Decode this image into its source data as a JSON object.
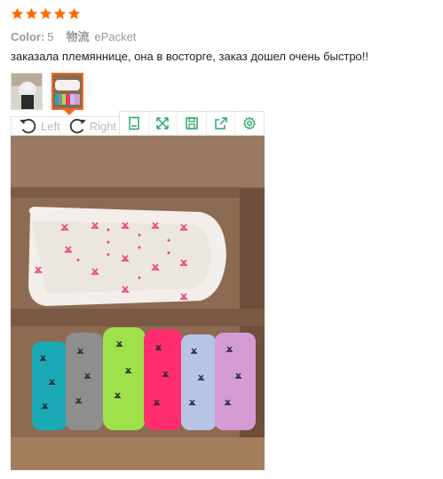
{
  "review": {
    "rating": 5,
    "color_label": "Color:",
    "color_value": "5",
    "shipping_label": "物流",
    "shipping_value": "ePacket",
    "text": "заказала племяннице, она в восторге, заказ дошел очень быстро!!"
  },
  "viewer": {
    "rotate_left_label": "Left",
    "rotate_right_label": "Right"
  },
  "colors": {
    "star": "#ff6a00",
    "accent": "#f26b1d",
    "toolbar_icon": "#2ba86a"
  }
}
